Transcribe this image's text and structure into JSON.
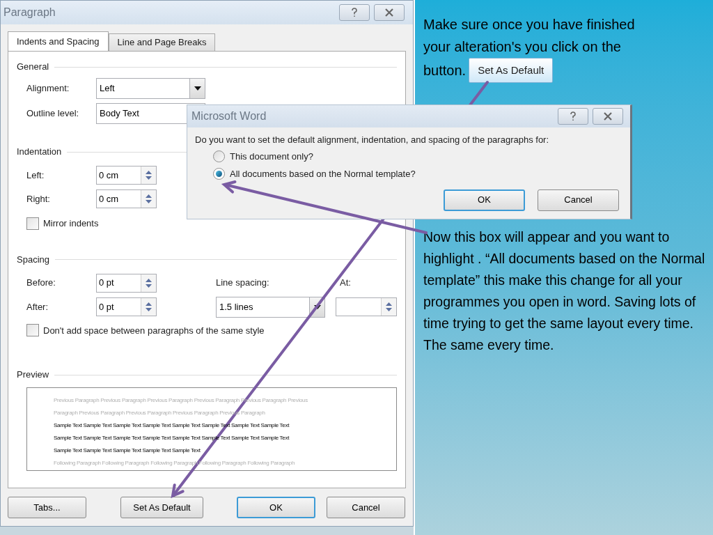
{
  "paragraph_dialog": {
    "title": "Paragraph",
    "tabs": [
      {
        "label": "Indents and Spacing",
        "selected": true
      },
      {
        "label": "Line and Page Breaks",
        "selected": false
      }
    ],
    "general": {
      "heading": "General",
      "alignment": {
        "label": "Alignment:",
        "value": "Left"
      },
      "outline_level": {
        "label": "Outline level:",
        "value": "Body Text"
      }
    },
    "indentation": {
      "heading": "Indentation",
      "left": {
        "label": "Left:",
        "value": "0 cm"
      },
      "right": {
        "label": "Right:",
        "value": "0 cm"
      },
      "mirror_indents": {
        "label": "Mirror indents",
        "checked": false
      }
    },
    "spacing": {
      "heading": "Spacing",
      "before": {
        "label": "Before:",
        "value": "0 pt"
      },
      "after": {
        "label": "After:",
        "value": "0 pt"
      },
      "line_spacing": {
        "label": "Line spacing:",
        "value": "1.5 lines"
      },
      "at": {
        "label": "At:"
      },
      "dont_add_space": {
        "label": "Don't add space between paragraphs of the same style",
        "checked": false
      }
    },
    "preview": {
      "heading": "Preview",
      "lines": [
        {
          "kind": "surrounding",
          "text": "Previous Paragraph Previous Paragraph Previous Paragraph Previous Paragraph Previous Paragraph Previous"
        },
        {
          "kind": "surrounding",
          "text": "Paragraph Previous Paragraph Previous Paragraph Previous Paragraph Previous Paragraph"
        },
        {
          "kind": "sample",
          "text": "Sample Text Sample Text Sample Text Sample Text Sample Text Sample Text Sample Text Sample Text"
        },
        {
          "kind": "sample",
          "text": "Sample Text Sample Text Sample Text Sample Text Sample Text Sample Text Sample Text Sample Text"
        },
        {
          "kind": "sample",
          "text": "Sample Text Sample Text Sample Text Sample Text Sample Text"
        },
        {
          "kind": "surrounding",
          "text": "Following Paragraph Following Paragraph Following Paragraph Following Paragraph Following Paragraph"
        }
      ]
    },
    "buttons": [
      {
        "label": "Tabs...",
        "default": false
      },
      {
        "label": "Set As Default",
        "default": false
      },
      {
        "label": "OK",
        "default": true
      },
      {
        "label": "Cancel",
        "default": false
      }
    ]
  },
  "word_dialog": {
    "title": "Microsoft Word",
    "question": "Do you want to set the default alignment, indentation, and spacing of the paragraphs for:",
    "options": [
      {
        "label": "This document only?",
        "selected": false
      },
      {
        "label": "All documents based on the Normal template?",
        "selected": true
      }
    ],
    "buttons": [
      {
        "label": "OK",
        "default": true
      },
      {
        "label": "Cancel",
        "default": false
      }
    ]
  },
  "slide": {
    "instruction": [
      "Make sure once you have finished your alteration's you click on the",
      "button."
    ],
    "callout_button": "Set As Default",
    "explanation": "Now this box will appear and you want to highlight . “All documents based on the Normal template” this make this change for all your programmes you open in word. Saving lots of time trying to get the same layout every time. The same every time."
  }
}
